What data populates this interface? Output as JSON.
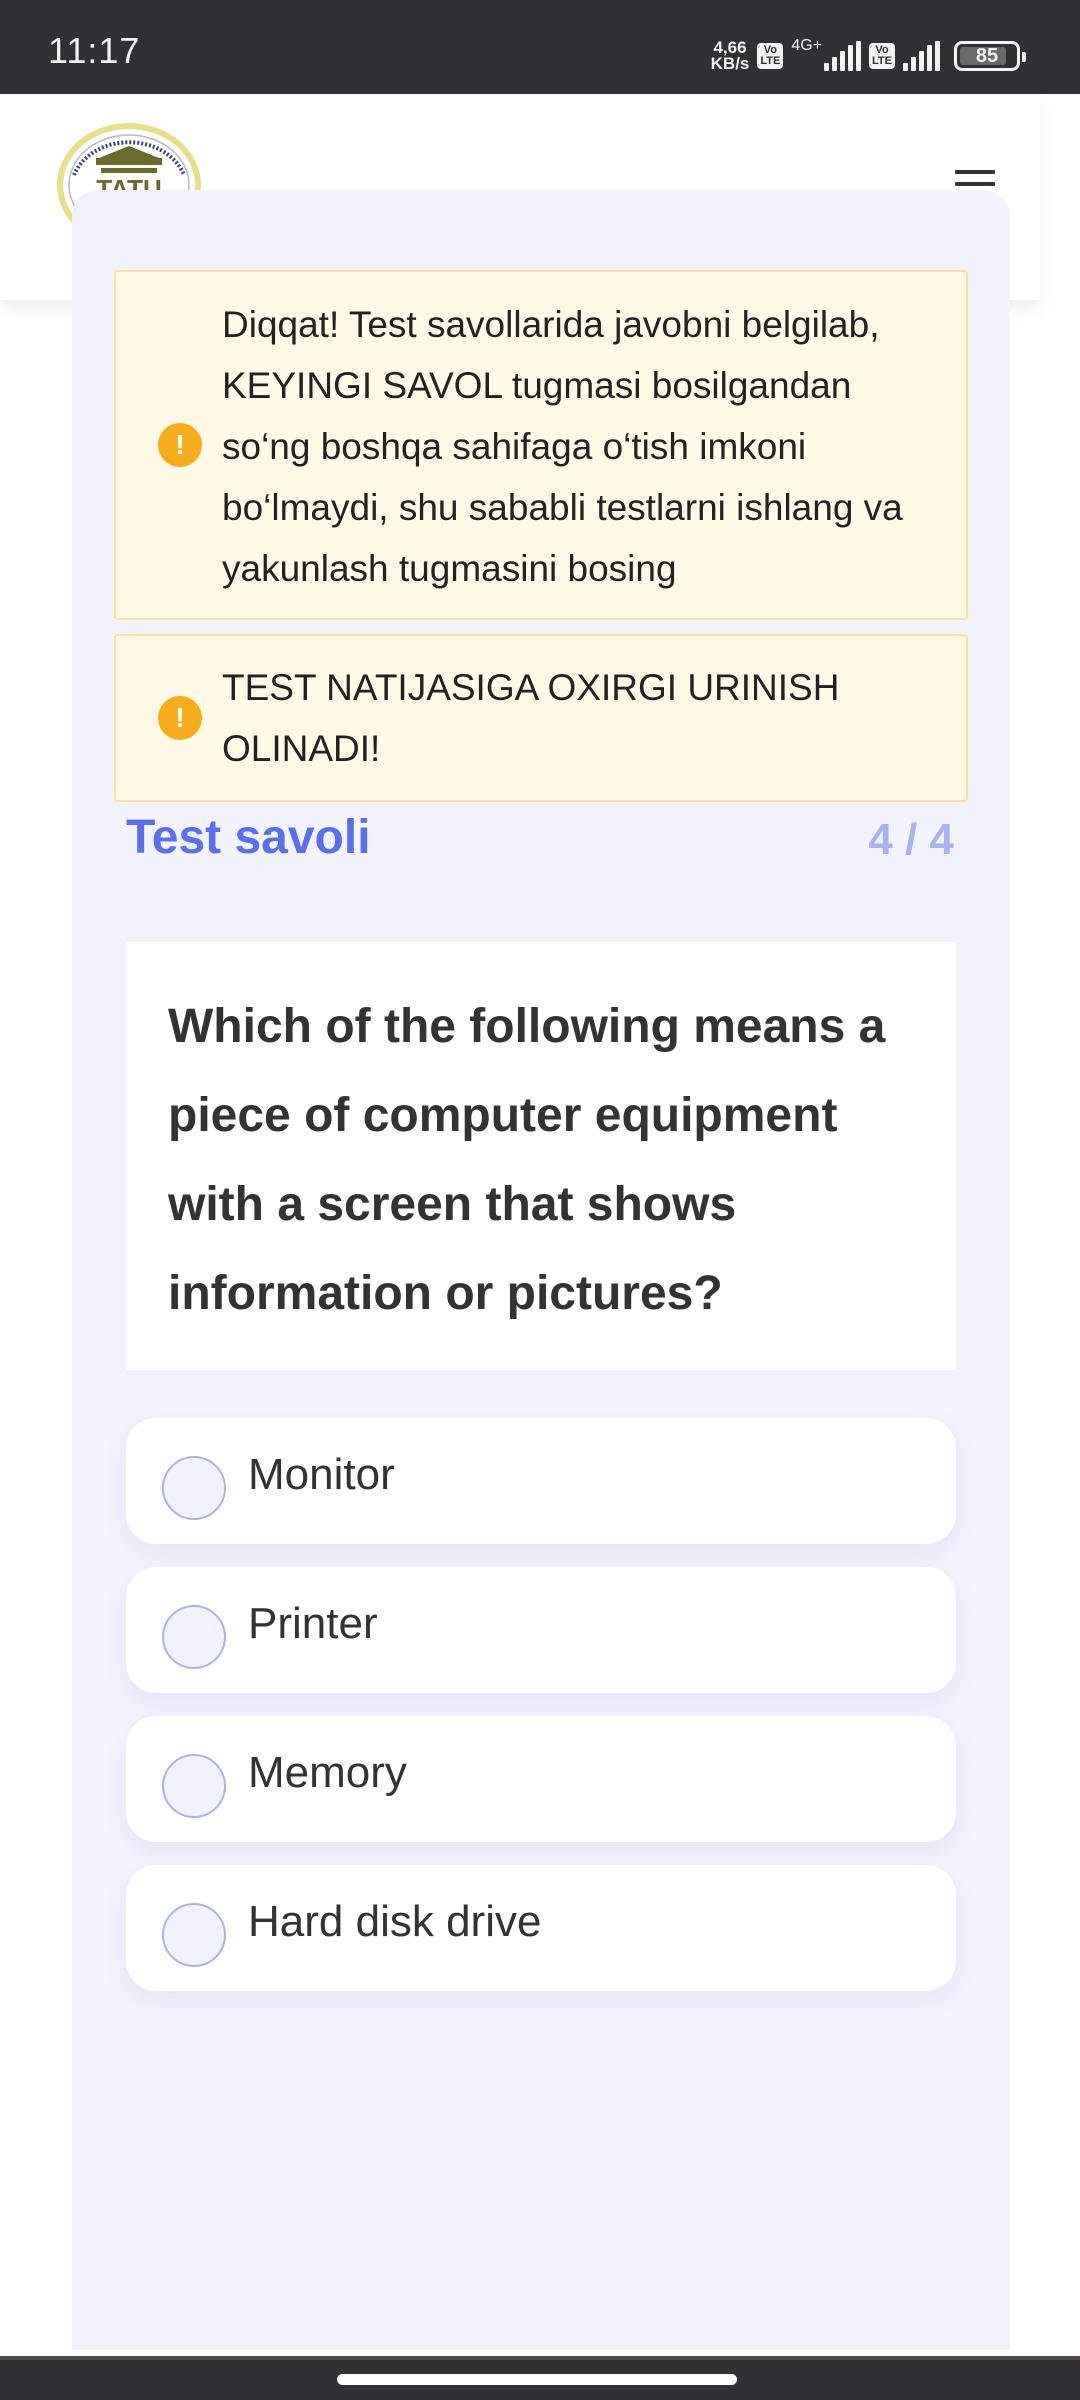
{
  "status_bar": {
    "time": "11:17",
    "net_speed_value": "4,66",
    "net_speed_unit": "KB/s",
    "volte_top": "Vo",
    "volte_bottom": "LTE",
    "network_type": "4G+",
    "battery_percent": 85
  },
  "header": {
    "logo_text": "TATU",
    "logo_alt": "Muhammad al-Xorazmiy nomidagi Toshkent axborot texnologiyalari universiteti",
    "menu_icon": "hamburger-menu-icon"
  },
  "alerts": [
    {
      "icon": "!",
      "text": "Diqqat! Test savollarida javobni belgilab, KEYINGI SAVOL tugmasi bosilgandan so‘ng boshqa sahifaga o‘tish imkoni bo‘lmaydi, shu sababli testlarni ishlang va yakunlash tugmasini bosing"
    },
    {
      "icon": "!",
      "text": "TEST NATIJASIGA OXIRGI URINISH OLINADI!"
    }
  ],
  "question": {
    "section_title": "Test savoli",
    "counter": "4 / 4",
    "current": 4,
    "total": 4,
    "text": "Which of the following means a piece of computer equipment with a screen that shows information or pictures?"
  },
  "options": [
    {
      "label": "Monitor",
      "selected": false
    },
    {
      "label": "Printer",
      "selected": false
    },
    {
      "label": "Memory",
      "selected": false
    },
    {
      "label": "Hard disk drive",
      "selected": false
    }
  ],
  "colors": {
    "accent": "#5c6ef0",
    "counter": "#a9b3ef",
    "warning_bg": "#fff9e6",
    "warning_border": "#f9e29c",
    "warning_icon": "#f8ad1c",
    "panel_bg": "#f3f3fd",
    "status_bar_bg": "#303134"
  }
}
